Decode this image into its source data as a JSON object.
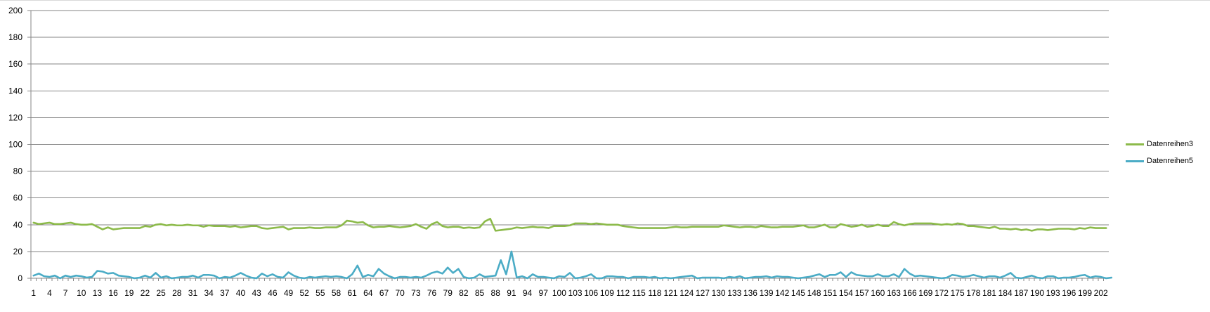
{
  "chart_data": {
    "type": "line",
    "title": "",
    "xlabel": "",
    "ylabel": "",
    "ylim": [
      0,
      200
    ],
    "y_ticks": [
      0,
      20,
      40,
      60,
      80,
      100,
      120,
      140,
      160,
      180,
      200
    ],
    "x_tick_step": 3,
    "grid": "horizontal",
    "legend_placement": "right",
    "series": [
      {
        "name": "Datenreihen3",
        "color": "#8cba4a",
        "values": [
          41.5,
          40.5,
          41,
          41.5,
          40.5,
          40.5,
          41,
          41.5,
          40.5,
          40,
          40,
          40.5,
          38.5,
          36.5,
          38,
          36.5,
          37,
          37.5,
          37.5,
          37.5,
          37.5,
          39,
          38.5,
          40,
          40.5,
          39.5,
          40,
          39.5,
          39.5,
          40,
          39.5,
          39.5,
          38.5,
          39.5,
          39,
          39,
          39,
          38.5,
          39,
          38,
          38.5,
          39,
          39,
          37.5,
          37,
          37.5,
          38,
          38.5,
          36.5,
          37.5,
          37.5,
          37.5,
          38,
          37.5,
          37.5,
          38,
          38,
          38,
          39.5,
          43,
          42.5,
          41.5,
          42,
          39.5,
          38,
          38.5,
          38.5,
          39,
          38.5,
          38,
          38.5,
          39,
          40.5,
          38.5,
          37,
          40.5,
          42,
          39,
          38,
          38.5,
          38.5,
          37.5,
          38,
          37.5,
          38,
          42.5,
          44.5,
          35.5,
          36,
          36.5,
          37,
          38,
          37.5,
          38,
          38.5,
          38,
          38,
          37.5,
          39,
          39,
          39,
          39.5,
          41,
          41,
          41,
          40.5,
          41,
          40.5,
          40,
          40,
          40,
          39,
          38.5,
          38,
          37.5,
          37.5,
          37.5,
          37.5,
          37.5,
          37.5,
          38,
          38.5,
          38,
          38,
          38.5,
          38.5,
          38.5,
          38.5,
          38.5,
          38.5,
          39.5,
          39,
          38.5,
          38,
          38.5,
          38.5,
          38,
          39,
          38.5,
          38,
          38,
          38.5,
          38.5,
          38.5,
          39,
          39.5,
          38,
          38,
          39,
          40,
          38,
          38,
          40.5,
          39.5,
          38.5,
          39,
          40,
          38.5,
          39,
          40,
          39,
          39,
          42,
          40.5,
          39.5,
          40.5,
          41,
          41,
          41,
          41,
          40.5,
          40,
          40.5,
          40,
          41,
          40.5,
          39,
          39,
          38.5,
          38,
          37.5,
          38.5,
          37,
          37,
          36.5,
          37,
          36,
          36.5,
          35.5,
          36.5,
          36.5,
          36,
          36.5,
          37,
          37,
          37,
          36.5,
          37.5,
          37,
          38,
          37.5,
          37.5,
          37.5
        ]
      },
      {
        "name": "Datenreihen5",
        "color": "#4bacc6",
        "values": [
          2,
          3.5,
          1.5,
          1,
          2,
          0,
          2,
          1,
          2,
          1.5,
          0.5,
          1,
          5.5,
          5,
          3.5,
          4,
          2,
          1.5,
          1,
          0,
          0.5,
          2,
          0.5,
          4,
          0.5,
          1.5,
          0,
          0.5,
          1,
          1,
          2,
          0.5,
          2.5,
          2.5,
          2,
          0,
          1,
          0.5,
          2,
          4,
          2,
          0.5,
          0,
          3.5,
          1.5,
          3,
          1,
          0.5,
          4.5,
          2,
          0.5,
          0,
          1,
          0.5,
          1,
          1.5,
          1,
          1.5,
          1,
          0,
          3,
          9.5,
          1,
          2.5,
          1.5,
          7,
          3.5,
          1.5,
          0,
          1,
          1,
          0.5,
          1,
          0.5,
          2,
          4,
          5,
          3.5,
          8,
          4,
          7,
          1,
          0,
          0.5,
          3,
          1,
          1.5,
          2,
          13.5,
          3,
          20,
          0.5,
          1.5,
          0,
          3,
          1,
          1,
          0.5,
          0,
          1.5,
          1,
          4,
          0,
          0.5,
          1.5,
          3,
          0,
          0,
          1.5,
          1.5,
          1,
          1,
          0,
          1,
          1,
          1,
          0.5,
          1,
          0,
          0.5,
          0,
          0.5,
          1,
          1.5,
          2,
          0,
          0.5,
          0.5,
          0.5,
          0.5,
          0,
          1,
          0.5,
          1.5,
          0,
          0.5,
          1,
          1,
          1.5,
          0.5,
          1.5,
          1,
          1,
          0.5,
          0,
          0.5,
          1,
          2,
          3,
          1,
          2.5,
          2.5,
          4.5,
          1,
          4.5,
          2.5,
          2,
          1.5,
          1.5,
          3,
          1.5,
          1.5,
          3,
          1,
          7,
          3.5,
          1.5,
          2,
          1.5,
          1,
          0.5,
          0,
          0.5,
          2.5,
          2,
          1,
          1.5,
          2.5,
          1.5,
          0.5,
          1.5,
          1.5,
          0.5,
          2,
          4,
          0.5,
          0,
          1,
          2,
          0.5,
          0,
          1.5,
          1.5,
          0,
          0.5,
          0.5,
          1,
          2,
          2.5,
          0.5,
          1.5,
          1,
          0,
          0.5
        ]
      }
    ]
  }
}
